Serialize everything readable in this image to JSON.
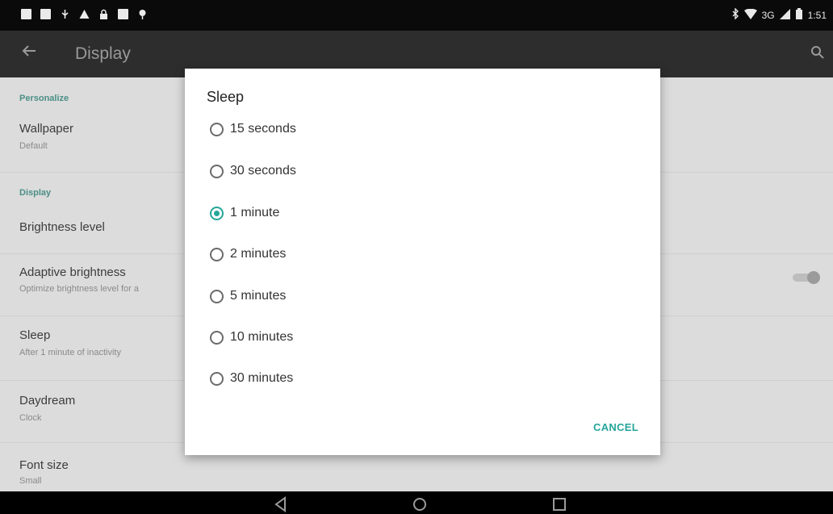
{
  "toolbar": {
    "title": "Display"
  },
  "settings": {
    "section_personalize": "Personalize",
    "wallpaper": {
      "title": "Wallpaper",
      "subtitle": "Default"
    },
    "section_display": "Display",
    "brightness": {
      "title": "Brightness level"
    },
    "adaptive": {
      "title": "Adaptive brightness",
      "subtitle": "Optimize brightness level for a"
    },
    "sleep": {
      "title": "Sleep",
      "subtitle": "After 1 minute of inactivity"
    },
    "daydream": {
      "title": "Daydream",
      "subtitle": "Clock"
    },
    "font_size": {
      "title": "Font size",
      "subtitle": "Small"
    }
  },
  "status": {
    "network": "3G",
    "time": "1:51"
  },
  "dialog": {
    "title": "Sleep",
    "options": [
      "15 seconds",
      "30 seconds",
      "1 minute",
      "2 minutes",
      "5 minutes",
      "10 minutes",
      "30 minutes"
    ],
    "selected": "1 minute",
    "cancel_label": "CANCEL"
  },
  "colors": {
    "accent": "#26a69a",
    "toolbar": "#2d2d2d"
  }
}
